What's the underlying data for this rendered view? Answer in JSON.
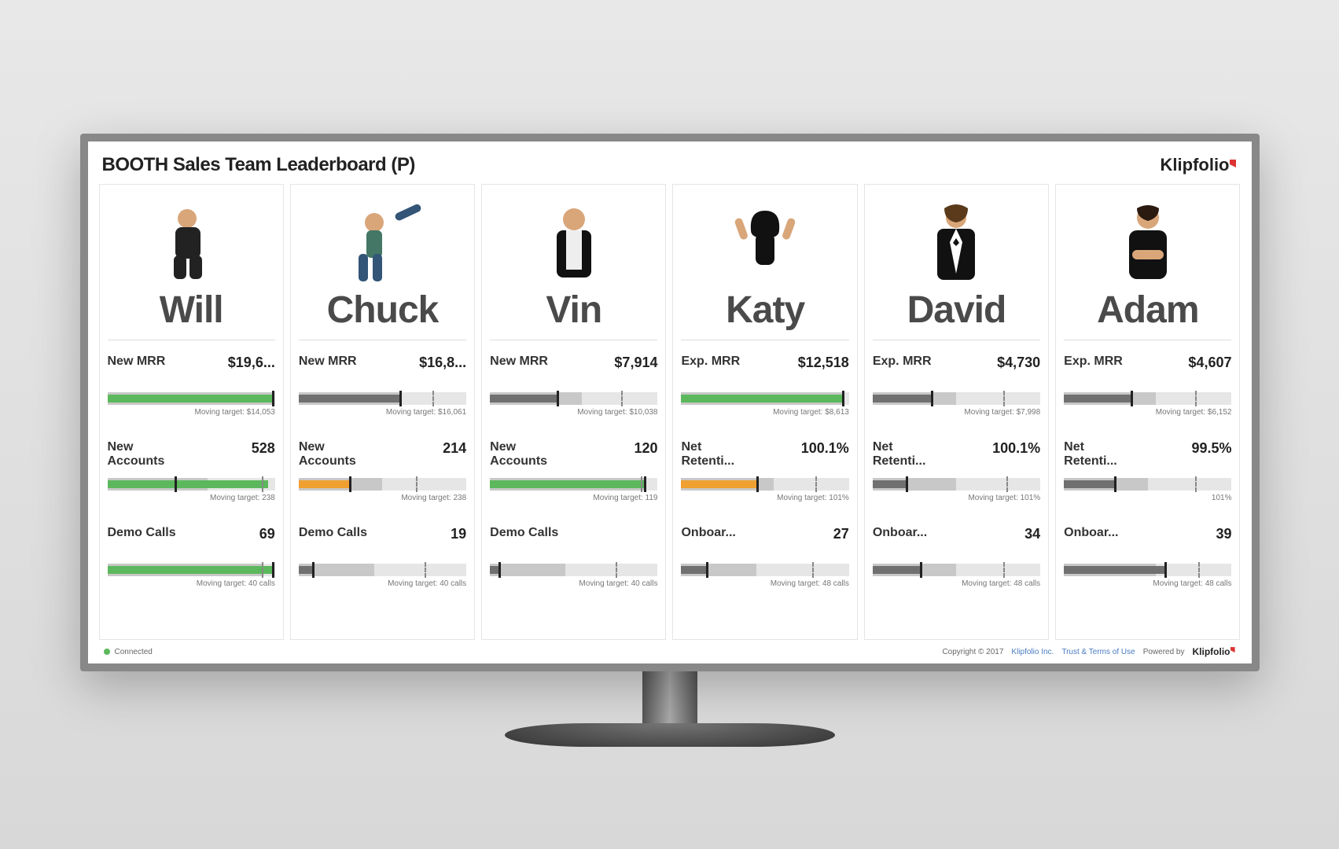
{
  "header": {
    "title": "BOOTH Sales Team Leaderboard (P)",
    "brand": "Klipfolio"
  },
  "people": [
    {
      "name": "Will",
      "avatar_hint": "man-crouching-suit",
      "metrics": [
        {
          "label": "New MRR",
          "value": "$19,6...",
          "bar_pct": 98,
          "bar_color": "green",
          "tick_pct": 98,
          "dash_pct": null,
          "range_pct": 98,
          "target_text": "Moving target: $14,053"
        },
        {
          "label": "New\nAccounts",
          "value": "528",
          "bar_pct": 96,
          "bar_color": "green",
          "tick_pct": 40,
          "dash_pct": 92,
          "range_pct": 60,
          "target_text": "Moving target: 238"
        },
        {
          "label": "Demo Calls",
          "value": "69",
          "bar_pct": 98,
          "bar_color": "green",
          "tick_pct": 98,
          "dash_pct": 92,
          "range_pct": 92,
          "target_text": "Moving target: 40 calls"
        }
      ]
    },
    {
      "name": "Chuck",
      "avatar_hint": "man-kicking",
      "metrics": [
        {
          "label": "New MRR",
          "value": "$16,8...",
          "bar_pct": 60,
          "bar_color": "gray",
          "tick_pct": 60,
          "dash_pct": 80,
          "range_pct": 60,
          "target_text": "Moving target: $16,061"
        },
        {
          "label": "New\nAccounts",
          "value": "214",
          "bar_pct": 30,
          "bar_color": "orange",
          "tick_pct": 30,
          "dash_pct": 70,
          "range_pct": 50,
          "target_text": "Moving target: 238"
        },
        {
          "label": "Demo Calls",
          "value": "19",
          "bar_pct": 8,
          "bar_color": "gray",
          "tick_pct": 8,
          "dash_pct": 75,
          "range_pct": 45,
          "target_text": "Moving target: 40 calls"
        }
      ]
    },
    {
      "name": "Vin",
      "avatar_hint": "bald-man-leather",
      "metrics": [
        {
          "label": "New MRR",
          "value": "$7,914",
          "bar_pct": 40,
          "bar_color": "gray",
          "tick_pct": 40,
          "dash_pct": 78,
          "range_pct": 55,
          "target_text": "Moving target: $10,038"
        },
        {
          "label": "New\nAccounts",
          "value": "120",
          "bar_pct": 92,
          "bar_color": "green",
          "tick_pct": 92,
          "dash_pct": 90,
          "range_pct": 92,
          "target_text": "Moving target: 119"
        },
        {
          "label": "Demo Calls",
          "value": "",
          "bar_pct": 5,
          "bar_color": "gray",
          "tick_pct": 5,
          "dash_pct": 75,
          "range_pct": 45,
          "target_text": "Moving target: 40 calls"
        }
      ]
    },
    {
      "name": "Katy",
      "avatar_hint": "woman-hands-up",
      "metrics": [
        {
          "label": "Exp. MRR",
          "value": "$12,518",
          "bar_pct": 96,
          "bar_color": "green",
          "tick_pct": 96,
          "dash_pct": null,
          "range_pct": 96,
          "target_text": "Moving target: $8,613"
        },
        {
          "label": "Net\nRetenti...",
          "value": "100.1%",
          "bar_pct": 45,
          "bar_color": "orange",
          "tick_pct": 45,
          "dash_pct": 80,
          "range_pct": 55,
          "target_text": "Moving target: 101%"
        },
        {
          "label": "Onboar...",
          "value": "27",
          "bar_pct": 15,
          "bar_color": "gray",
          "tick_pct": 15,
          "dash_pct": 78,
          "range_pct": 45,
          "target_text": "Moving target: 48 calls"
        }
      ]
    },
    {
      "name": "David",
      "avatar_hint": "man-tuxedo",
      "metrics": [
        {
          "label": "Exp. MRR",
          "value": "$4,730",
          "bar_pct": 35,
          "bar_color": "gray",
          "tick_pct": 35,
          "dash_pct": 78,
          "range_pct": 50,
          "target_text": "Moving target: $7,998"
        },
        {
          "label": "Net\nRetenti...",
          "value": "100.1%",
          "bar_pct": 20,
          "bar_color": "gray",
          "tick_pct": 20,
          "dash_pct": 80,
          "range_pct": 50,
          "target_text": "Moving target: 101%"
        },
        {
          "label": "Onboar...",
          "value": "34",
          "bar_pct": 28,
          "bar_color": "gray",
          "tick_pct": 28,
          "dash_pct": 78,
          "range_pct": 50,
          "target_text": "Moving target: 48 calls"
        }
      ]
    },
    {
      "name": "Adam",
      "avatar_hint": "man-tshirt-arms-crossed",
      "metrics": [
        {
          "label": "Exp. MRR",
          "value": "$4,607",
          "bar_pct": 40,
          "bar_color": "gray",
          "tick_pct": 40,
          "dash_pct": 78,
          "range_pct": 55,
          "target_text": "Moving target: $6,152"
        },
        {
          "label": "Net\nRetenti...",
          "value": "99.5%",
          "bar_pct": 30,
          "bar_color": "gray",
          "tick_pct": 30,
          "dash_pct": 78,
          "range_pct": 50,
          "target_text": "101%"
        },
        {
          "label": "Onboar...",
          "value": "39",
          "bar_pct": 60,
          "bar_color": "gray",
          "tick_pct": 60,
          "dash_pct": 80,
          "range_pct": 55,
          "target_text": "Moving target: 48 calls"
        }
      ]
    }
  ],
  "footer": {
    "status": "Connected",
    "copyright": "Copyright © 2017",
    "company": "Klipfolio Inc.",
    "legal": "Trust & Terms of Use",
    "powered_label": "Powered by",
    "powered_brand": "Klipfolio"
  },
  "colors": {
    "green": "#5cb85c",
    "orange": "#f0a030",
    "gray_text": "#4a4a4a"
  }
}
